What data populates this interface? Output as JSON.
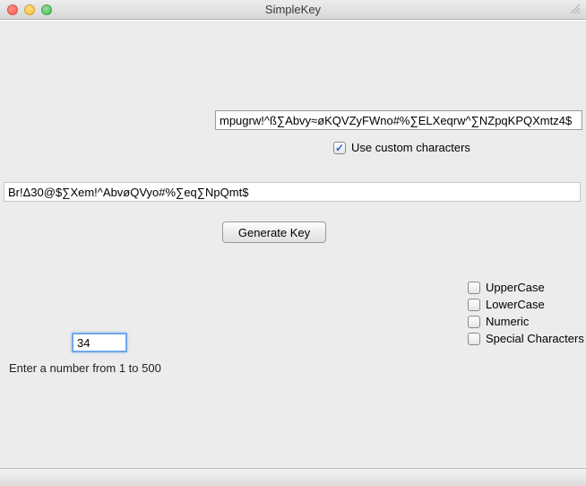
{
  "window": {
    "title": "SimpleKey"
  },
  "customChars": {
    "value": "mpugrw!^ß∑Abvy≈øKQVZyFWno#%∑ELXeqrw^∑NZpqKPQXmtz4$",
    "checkboxLabel": "Use custom characters"
  },
  "output": {
    "value": "Br!Δ30@$∑Xem!^AbvøQVyo#%∑eq∑NpQmt$"
  },
  "buttons": {
    "generate": "Generate Key"
  },
  "options": {
    "uppercase": "UpperCase",
    "lowercase": "LowerCase",
    "numeric": "Numeric",
    "special": "Special Characters"
  },
  "length": {
    "value": "34",
    "hint": "Enter a number from 1 to 500"
  }
}
